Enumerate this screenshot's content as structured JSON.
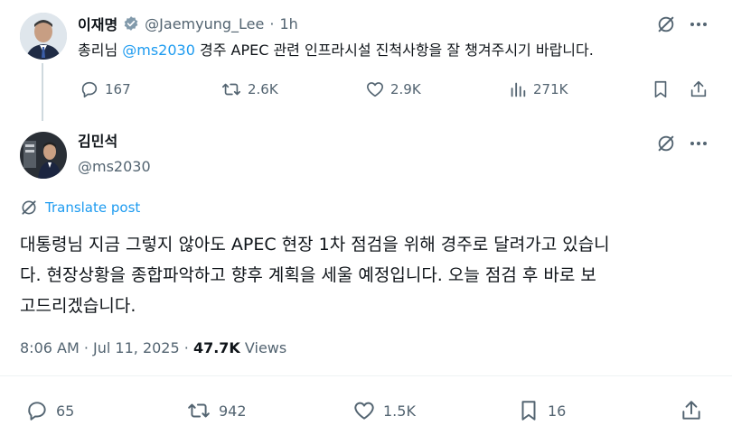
{
  "parent_tweet": {
    "author_name": "이재명",
    "author_handle": "@Jaemyung_Lee",
    "separator": "·",
    "time": "1h",
    "text_before": "총리님 ",
    "mention": "@ms2030",
    "text_after": " 경주 APEC 관련 인프라시설 진척사항을 잘 챙겨주시기 바랍니다.",
    "replies": "167",
    "reposts": "2.6K",
    "likes": "2.9K",
    "views": "271K"
  },
  "main_tweet": {
    "author_name": "김민석",
    "author_handle": "@ms2030",
    "translate_label": "Translate post",
    "text_line1": "대통령님 지금 그렇지 않아도 APEC 현장 1차 점검을 위해 경주로 달려가고 있습니",
    "text_line2": "다. 현장상황을 종합파악하고 향후 계획을 세울 예정입니다. 오늘 점검 후 바로 보",
    "text_line3": "고드리겠습니다.",
    "timestamp": "8:06 AM · Jul 11, 2025",
    "dot": "·",
    "views_count": "47.7K",
    "views_label": "Views",
    "replies": "65",
    "reposts": "942",
    "likes": "1.5K",
    "bookmarks": "16"
  },
  "colors": {
    "accent": "#1d9bf0",
    "muted": "#536471",
    "text": "#0f1419",
    "verified_badge": "#829aab"
  },
  "icons": [
    "grok-icon",
    "more-icon",
    "reply-icon",
    "repost-icon",
    "like-icon",
    "views-icon",
    "bookmark-icon",
    "share-icon",
    "translate-icon",
    "verified-badge-icon"
  ]
}
